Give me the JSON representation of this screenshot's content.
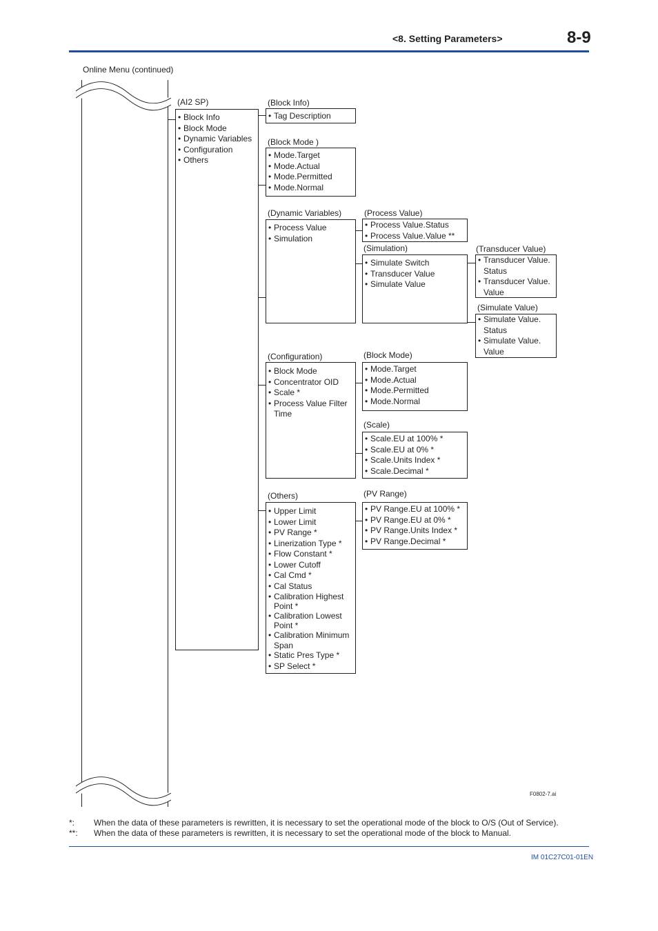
{
  "header": {
    "section": "<8.  Setting Parameters>",
    "page_number": "8-9",
    "accent_color": "#1f4ea1"
  },
  "figure": {
    "caption": "Online Menu (continued)",
    "figure_id": "F0802-7.ai",
    "root": {
      "label": "(AI2 SP)",
      "items": [
        "Block Info",
        "Block Mode",
        "Dynamic Variables",
        "Configuration",
        "Others"
      ]
    },
    "block_info": {
      "label": "(Block Info)",
      "items": [
        "Tag Description"
      ]
    },
    "block_mode": {
      "label": "(Block Mode )",
      "items": [
        "Mode.Target",
        "Mode.Actual",
        "Mode.Permitted",
        "Mode.Normal"
      ]
    },
    "dynamic_variables": {
      "label": "(Dynamic Variables)",
      "items": [
        "Process Value",
        "Simulation"
      ]
    },
    "process_value": {
      "label": "(Process Value)",
      "items": [
        "Process Value.Status",
        "Process Value.Value **"
      ]
    },
    "simulation": {
      "label": "(Simulation)",
      "items": [
        "Simulate Switch",
        "Transducer Value",
        "Simulate Value"
      ]
    },
    "transducer_value": {
      "label": "(Transducer Value)",
      "items": [
        "Transducer Value.\nStatus",
        "Transducer Value.\nValue"
      ]
    },
    "simulate_value": {
      "label": "(Simulate Value)",
      "items": [
        "Simulate Value.\nStatus",
        "Simulate Value.\nValue"
      ]
    },
    "configuration": {
      "label": "(Configuration)",
      "items": [
        "Block Mode",
        "Concentrator OID",
        "Scale *",
        "Process Value Filter\nTime"
      ]
    },
    "config_block_mode": {
      "label": "(Block Mode)",
      "items": [
        "Mode.Target",
        "Mode.Actual",
        "Mode.Permitted",
        "Mode.Normal"
      ]
    },
    "scale": {
      "label": "(Scale)",
      "items": [
        "Scale.EU at 100% *",
        "Scale.EU at 0% *",
        "Scale.Units Index *",
        "Scale.Decimal *"
      ]
    },
    "others": {
      "label": "(Others)",
      "items": [
        "Upper Limit",
        "Lower Limit",
        "PV Range *",
        "Linerization Type *",
        "Flow Constant *",
        "Lower Cutoff",
        "Cal Cmd *",
        "Cal Status",
        "Calibration Highest\nPoint *",
        "Calibration Lowest\nPoint *",
        "Calibration Minimum\nSpan",
        "Static Pres Type *",
        "SP Select *"
      ]
    },
    "pv_range": {
      "label": "(PV Range)",
      "items": [
        "PV Range.EU at 100% *",
        "PV Range.EU at 0% *",
        "PV Range.Units Index *",
        "PV Range.Decimal *"
      ]
    }
  },
  "notes": [
    {
      "mark": "*:",
      "text": "When the data of these parameters is rewritten, it is necessary to set the operational mode of the block to O/S (Out of Service)."
    },
    {
      "mark": "**:",
      "text": "When the data of these parameters is rewritten, it is necessary to set the operational mode of the block to Manual."
    }
  ],
  "footer": {
    "doc_number": "IM 01C27C01-01EN"
  }
}
